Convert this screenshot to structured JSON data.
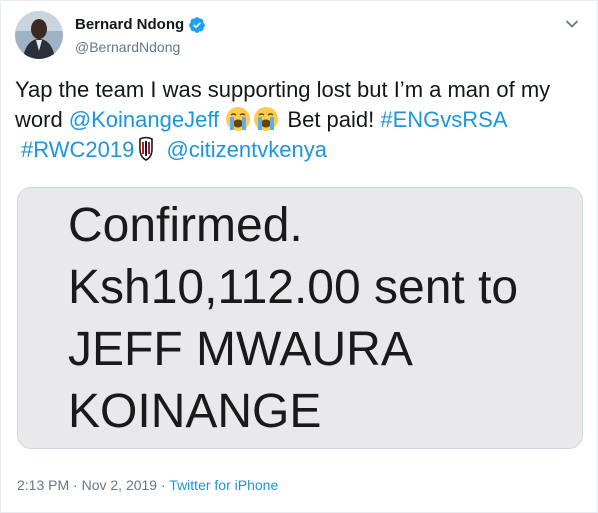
{
  "author": {
    "display_name": "Bernard Ndong",
    "handle": "@BernardNdong",
    "verified": true
  },
  "tweet": {
    "text_1": "Yap the team I was supporting lost but I’m a man of my word ",
    "mention_1": "@KoinangeJeff",
    "emojis": [
      "loudly-crying-face",
      "loudly-crying-face"
    ],
    "text_2": " Bet paid! ",
    "hashtag_1": "#ENGvsRSA",
    "hashtag_2": "#RWC2019",
    "hashtag_2_icon": "rugby-world-cup-icon",
    "mention_2": "@citizentvkenya"
  },
  "media": {
    "lines": [
      "Confirmed.",
      "Ksh10,112.00 sent to",
      "JEFF MWAURA",
      "KOINANGE"
    ]
  },
  "meta": {
    "time": "2:13 PM",
    "separator_1": " · ",
    "date": "Nov 2, 2019",
    "separator_2": " · ",
    "source": "Twitter for iPhone"
  },
  "colors": {
    "link": "#1b95e0",
    "text": "#14171a",
    "secondary": "#657786",
    "verified": "#1da1f2",
    "media_bg": "#e9e9ec"
  }
}
